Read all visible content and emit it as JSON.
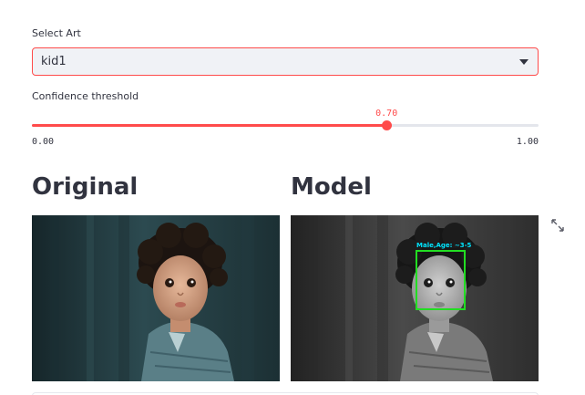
{
  "select": {
    "label": "Select Art",
    "value": "kid1"
  },
  "slider": {
    "label": "Confidence threshold",
    "value": 0.7,
    "value_text": "0.70",
    "min": 0.0,
    "max": 1.0,
    "min_text": "0.00",
    "max_text": "1.00"
  },
  "sections": {
    "original_heading": "Original",
    "model_heading": "Model"
  },
  "detection": {
    "label": "Male,Age: ~3-5",
    "box_color": "#22dd22",
    "label_color": "#00e5ff"
  },
  "colors": {
    "accent": "#ff4b4b",
    "text": "#31333f",
    "select_bg": "#f0f2f6"
  },
  "icons": {
    "expand": "expand-icon",
    "dropdown": "chevron-down-icon"
  }
}
